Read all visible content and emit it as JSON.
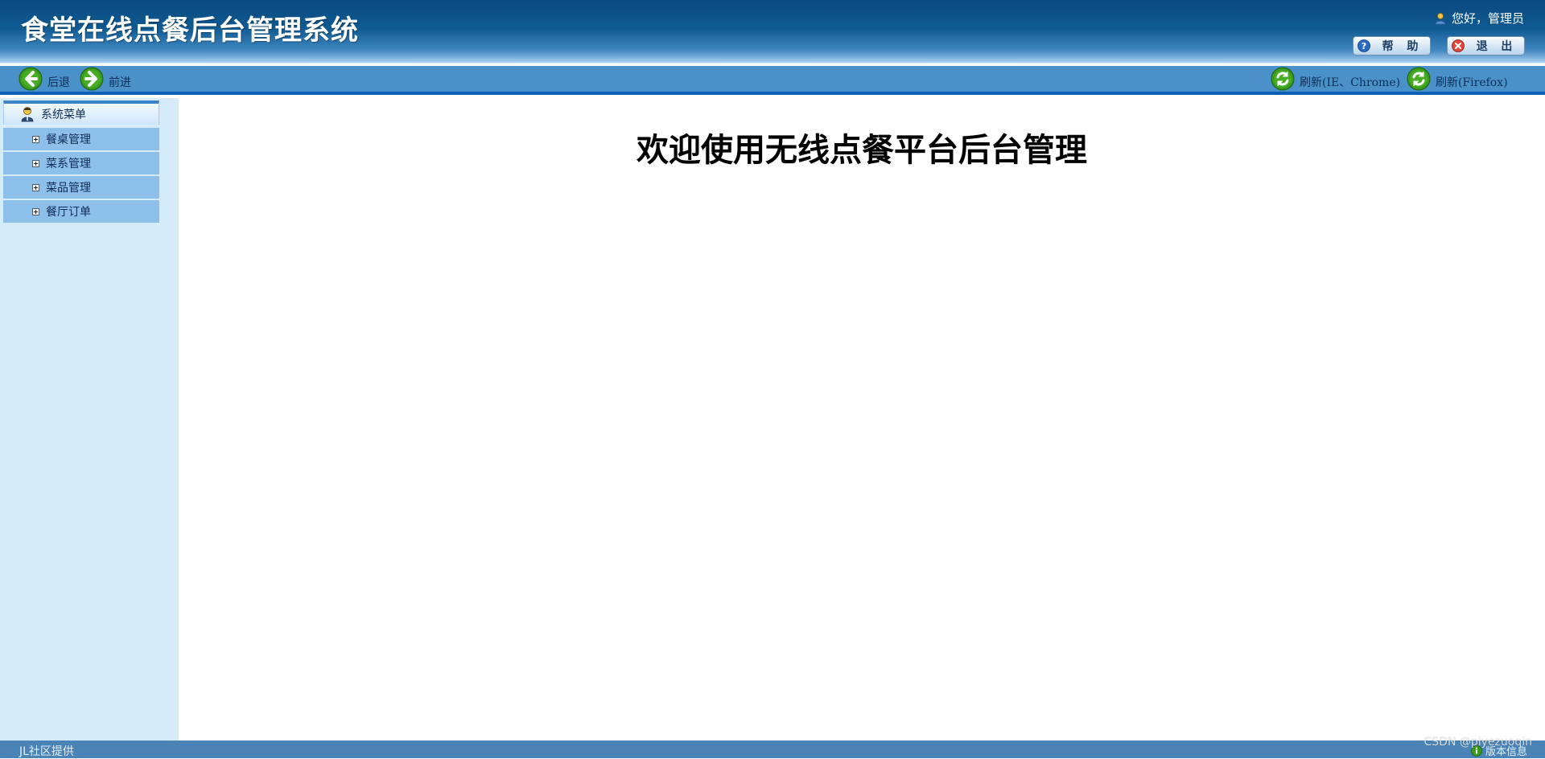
{
  "header": {
    "app_title": "食堂在线点餐后台管理系统",
    "greeting": "您好，管理员",
    "help_label": "帮 助",
    "logout_label": "退 出"
  },
  "toolbar": {
    "back_label": "后退",
    "forward_label": "前进",
    "refresh_ie_label": "刷新(IE、Chrome)",
    "refresh_ff_label": "刷新(Firefox)"
  },
  "sidebar": {
    "menu_title": "系统菜单",
    "items": [
      {
        "label": "餐桌管理"
      },
      {
        "label": "菜系管理"
      },
      {
        "label": "菜品管理"
      },
      {
        "label": "餐厅订单"
      }
    ]
  },
  "main": {
    "welcome": "欢迎使用无线点餐平台后台管理"
  },
  "footer": {
    "provider": "JL社区提供",
    "version_label": "版本信息",
    "watermark": "CSDN @piyezuoqin"
  },
  "colors": {
    "header_dark": "#0a4a7e",
    "toolbar": "#4a91c9",
    "toolbar_border": "#0a5fb8",
    "sidebar_bg": "#d6ebfa",
    "menu_item": "#8cc0ea",
    "footer": "#4a83b6",
    "nav_green": "#3a9a1e"
  },
  "icons": {
    "user": "user-icon",
    "help": "help-icon",
    "logout": "logout-icon",
    "back": "arrow-left-icon",
    "forward": "arrow-right-icon",
    "refresh": "refresh-icon",
    "menu": "admin-user-icon",
    "expand": "plus-box-icon"
  }
}
